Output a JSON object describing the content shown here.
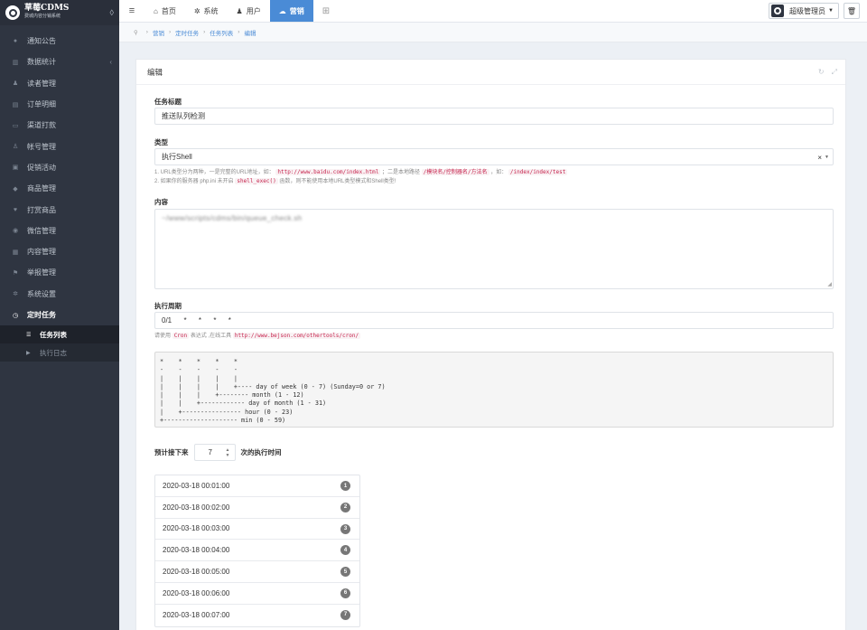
{
  "sidebar": {
    "logo_title": "草莓CDMS",
    "logo_subtitle": "费城内容分销系统",
    "items": [
      {
        "label": "通知公告",
        "icon": "comment-icon",
        "glyph": "●"
      },
      {
        "label": "数据统计",
        "icon": "bar-chart-icon",
        "glyph": "▥",
        "arrow": "‹"
      },
      {
        "label": "读者管理",
        "icon": "user-icon",
        "glyph": "♟"
      },
      {
        "label": "订单明细",
        "icon": "cart-icon",
        "glyph": "▤"
      },
      {
        "label": "渠道打款",
        "icon": "credit-card-icon",
        "glyph": "▭"
      },
      {
        "label": "帐号管理",
        "icon": "user-plus-icon",
        "glyph": "♙"
      },
      {
        "label": "促销活动",
        "icon": "gift-icon",
        "glyph": "▣"
      },
      {
        "label": "商品管理",
        "icon": "diamond-icon",
        "glyph": "◆"
      },
      {
        "label": "打赏商品",
        "icon": "heart-icon",
        "glyph": "♥"
      },
      {
        "label": "微信管理",
        "icon": "wechat-icon",
        "glyph": "◉"
      },
      {
        "label": "内容管理",
        "icon": "book-icon",
        "glyph": "▦"
      },
      {
        "label": "举报管理",
        "icon": "flag-icon",
        "glyph": "⚑"
      },
      {
        "label": "系统设置",
        "icon": "gear-icon",
        "glyph": "✲"
      },
      {
        "label": "定时任务",
        "icon": "clock-icon",
        "glyph": "◷",
        "active": true
      }
    ],
    "submenu": [
      {
        "label": "任务列表",
        "icon": "list-icon",
        "glyph": "☰",
        "active": true
      },
      {
        "label": "执行日志",
        "icon": "caret-right-icon",
        "glyph": "▶"
      }
    ]
  },
  "topbar": {
    "tabs": [
      {
        "label": "首页",
        "icon": "home-icon",
        "glyph": "⌂"
      },
      {
        "label": "系统",
        "icon": "gear-icon",
        "glyph": "✲"
      },
      {
        "label": "用户",
        "icon": "user-icon",
        "glyph": "♟"
      },
      {
        "label": "营销",
        "icon": "cloud-icon",
        "glyph": "☁",
        "active": true
      }
    ],
    "admin_label": "超级管理员"
  },
  "breadcrumb": [
    "营销",
    "定时任务",
    "任务列表",
    "编辑"
  ],
  "panel": {
    "title": "编辑",
    "task_title_label": "任务标题",
    "task_title_value": "推送队列检测",
    "type_label": "类型",
    "type_value": "执行Shell",
    "help1_a": "1. URL类型分为两种，一是完整的URL地址，如：",
    "help1_code1": "http://www.baidu.com/index.html",
    "help1_b": "；二是本地路径",
    "help1_code2": "/模块名/控制器名/方法名",
    "help1_c": "，如：",
    "help1_code3": "/index/index/test",
    "help2_a": "2. 如果你的服务器 php.ini 未开启",
    "help2_code": "shell_exec()",
    "help2_b": "函数，则不能使用本地URL类型模式和Shell类型!",
    "content_label": "内容",
    "content_value": "~/www/scripts/cdms/bin/queue_check.sh",
    "schedule_label": "执行周期",
    "schedule_value": "0/1      *      *      *      *",
    "cron_help_a": "请使用",
    "cron_help_code": "Cron",
    "cron_help_b": "表达式 ,在线工具",
    "cron_help_url": "http://www.bejson.com/othertools/cron/",
    "cron_diagram": "*    *    *    *    *\n-    -    -    -    -\n|    |    |    |    |\n|    |    |    |    +---- day of week (0 - 7) (Sunday=0 or 7)\n|    |    |    +-------- month (1 - 12)\n|    |    +------------ day of month (1 - 31)\n|    +---------------- hour (0 - 23)\n+-------------------- min (0 - 59)",
    "next_prefix": "预计接下来",
    "next_count": "7",
    "next_suffix": "次的执行时间",
    "runs": [
      {
        "time": "2020-03-18 00:01:00",
        "n": "1"
      },
      {
        "time": "2020-03-18 00:02:00",
        "n": "2"
      },
      {
        "time": "2020-03-18 00:03:00",
        "n": "3"
      },
      {
        "time": "2020-03-18 00:04:00",
        "n": "4"
      },
      {
        "time": "2020-03-18 00:05:00",
        "n": "5"
      },
      {
        "time": "2020-03-18 00:06:00",
        "n": "6"
      },
      {
        "time": "2020-03-18 00:07:00",
        "n": "7"
      }
    ]
  },
  "colors": {
    "sidebar_bg": "#2f3541",
    "accent": "#4a8bd6",
    "badge": "#777777"
  }
}
